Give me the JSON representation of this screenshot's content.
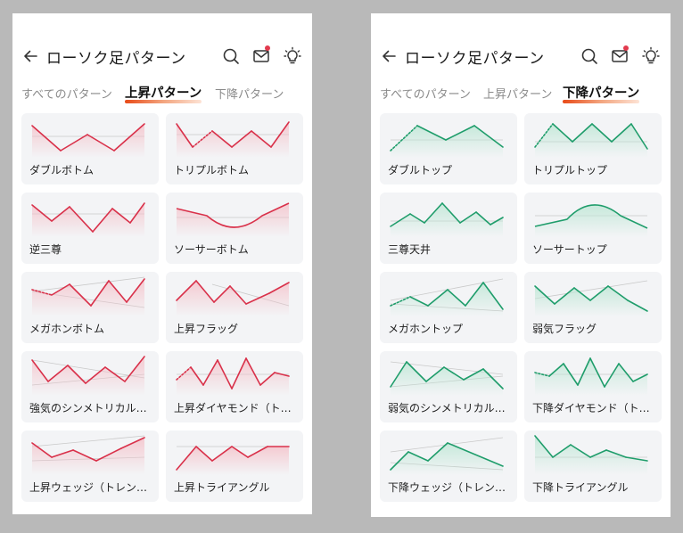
{
  "screens": [
    {
      "id": "left",
      "title": "ローソク足パターン",
      "active_tab": 1,
      "tabs": [
        "すべてのパターン",
        "上昇パターン",
        "下降パターン"
      ],
      "line_color": "#d9314a",
      "fill_color": "#f4c3cb",
      "cards": [
        {
          "label": "ダブルボトム",
          "icon": "double-bottom-chart-icon"
        },
        {
          "label": "トリプルボトム",
          "icon": "triple-bottom-chart-icon"
        },
        {
          "label": "逆三尊",
          "icon": "inverse-head-shoulders-chart-icon"
        },
        {
          "label": "ソーサーボトム",
          "icon": "saucer-bottom-chart-icon"
        },
        {
          "label": "メガホンボトム",
          "icon": "megaphone-bottom-chart-icon"
        },
        {
          "label": "上昇フラッグ",
          "icon": "bull-flag-chart-icon"
        },
        {
          "label": "強気のシンメトリカルトライアングル",
          "icon": "bullish-symmetrical-triangle-chart-icon"
        },
        {
          "label": "上昇ダイヤモンド（トップ）",
          "icon": "bullish-diamond-chart-icon"
        },
        {
          "label": "上昇ウェッジ（トレンド）",
          "icon": "rising-wedge-chart-icon"
        },
        {
          "label": "上昇トライアングル",
          "icon": "ascending-triangle-chart-icon"
        }
      ]
    },
    {
      "id": "right",
      "title": "ローソク足パターン",
      "active_tab": 2,
      "tabs": [
        "すべてのパターン",
        "上昇パターン",
        "下降パターン"
      ],
      "line_color": "#1f9d6b",
      "fill_color": "#bfe7d6",
      "cards": [
        {
          "label": "ダブルトップ",
          "icon": "double-top-chart-icon"
        },
        {
          "label": "トリプルトップ",
          "icon": "triple-top-chart-icon"
        },
        {
          "label": "三尊天井",
          "icon": "head-shoulders-chart-icon"
        },
        {
          "label": "ソーサートップ",
          "icon": "saucer-top-chart-icon"
        },
        {
          "label": "メガホントップ",
          "icon": "megaphone-top-chart-icon"
        },
        {
          "label": "弱気フラッグ",
          "icon": "bear-flag-chart-icon"
        },
        {
          "label": "弱気のシンメトリカルトライアングル",
          "icon": "bearish-symmetrical-triangle-chart-icon"
        },
        {
          "label": "下降ダイヤモンド（トップ）",
          "icon": "bearish-diamond-chart-icon"
        },
        {
          "label": "下降ウェッジ（トレンド）",
          "icon": "falling-wedge-chart-icon"
        },
        {
          "label": "下降トライアングル",
          "icon": "descending-triangle-chart-icon"
        }
      ]
    }
  ]
}
